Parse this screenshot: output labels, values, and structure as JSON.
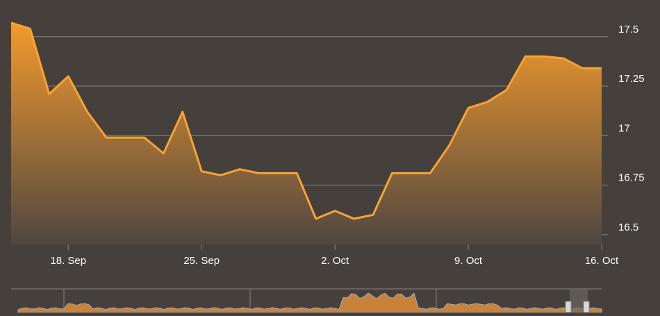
{
  "chart_data": {
    "type": "area",
    "title": "",
    "xlabel": "",
    "ylabel": "",
    "ylim": [
      16.45,
      17.58
    ],
    "xlim": [
      "2025-09-15",
      "2025-10-16"
    ],
    "y_ticks": [
      16.5,
      16.75,
      17,
      17.25,
      17.5
    ],
    "y_tick_labels": [
      "16.5",
      "16.75",
      "17",
      "17.25",
      "17.5"
    ],
    "x_ticks": [
      "2025-09-18",
      "2025-09-25",
      "2025-10-02",
      "2025-10-09",
      "2025-10-16"
    ],
    "x_tick_labels": [
      "18. Sep",
      "25. Sep",
      "2. Oct",
      "9. Oct",
      "16. Oct"
    ],
    "grid": "horizontal",
    "legend": "none",
    "colors": {
      "background": "#46403d",
      "line": "#f7a434",
      "area_top": "#f39a2c",
      "area_bottom": "#4f4741",
      "grid": "#8a8480",
      "text": "#ffffff",
      "navigator_area": "#c8823a"
    },
    "series": [
      {
        "x": [
          "2025-09-15",
          "2025-09-16",
          "2025-09-17",
          "2025-09-18",
          "2025-09-19",
          "2025-09-20",
          "2025-09-21",
          "2025-09-22",
          "2025-09-23",
          "2025-09-24",
          "2025-09-25",
          "2025-09-26",
          "2025-09-27",
          "2025-09-28",
          "2025-09-29",
          "2025-09-30",
          "2025-10-01",
          "2025-10-02",
          "2025-10-03",
          "2025-10-04",
          "2025-10-05",
          "2025-10-06",
          "2025-10-07",
          "2025-10-08",
          "2025-10-09",
          "2025-10-10",
          "2025-10-11",
          "2025-10-12",
          "2025-10-13",
          "2025-10-14",
          "2025-10-15",
          "2025-10-16"
        ],
        "values": [
          17.57,
          17.54,
          17.21,
          17.3,
          17.12,
          16.99,
          16.99,
          16.99,
          16.91,
          17.12,
          16.82,
          16.8,
          16.83,
          16.81,
          16.81,
          16.81,
          16.58,
          16.62,
          16.58,
          16.6,
          16.81,
          16.81,
          16.81,
          16.95,
          17.14,
          17.17,
          17.23,
          17.4,
          17.4,
          17.39,
          17.34,
          17.34
        ]
      }
    ]
  }
}
